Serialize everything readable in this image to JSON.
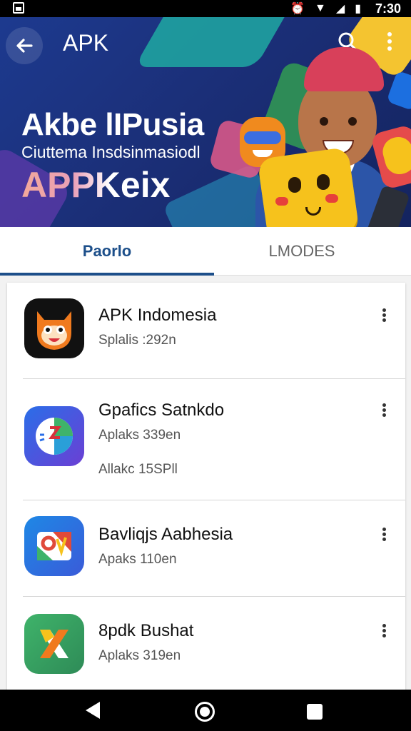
{
  "status_bar": {
    "time": "7:30",
    "icons": [
      "gallery-icon",
      "alarm-icon",
      "wifi-icon",
      "signal-icon",
      "battery-icon"
    ]
  },
  "header": {
    "title": "APK",
    "back_icon": "arrow-left-icon",
    "search_icon": "search-icon",
    "more_icon": "more-vertical-icon"
  },
  "hero": {
    "line1": "Akbe lIPusia",
    "line2": "Ciuttema Insdsinmasiodl",
    "line3": "APPKeix"
  },
  "tabs": [
    {
      "label": "Paorlo",
      "active": true
    },
    {
      "label": "LMODES",
      "active": false
    }
  ],
  "apps": [
    {
      "name": "APK Indomesia",
      "lines": [
        "Splalis :292n"
      ],
      "icon": "fox-mascot-icon"
    },
    {
      "name": "Gpafics Satnkdo",
      "lines": [
        "Aplaks 339en",
        "Allakc 15SPll"
      ],
      "icon": "clock-graphics-icon"
    },
    {
      "name": "Bavliqjs Aabhesia",
      "lines": [
        "Apaks 110en"
      ],
      "icon": "map-pin-icon"
    },
    {
      "name": "8pdk Bushat",
      "lines": [
        "Aplaks 319en"
      ],
      "icon": "x-logo-icon"
    }
  ],
  "colors": {
    "accent": "#1d4f8a",
    "hero_bg": "#1b2f78",
    "text_primary": "#111111",
    "text_secondary": "#555555"
  },
  "nav_bar": {
    "icons": [
      "nav-back-icon",
      "nav-home-icon",
      "nav-recents-icon"
    ]
  }
}
